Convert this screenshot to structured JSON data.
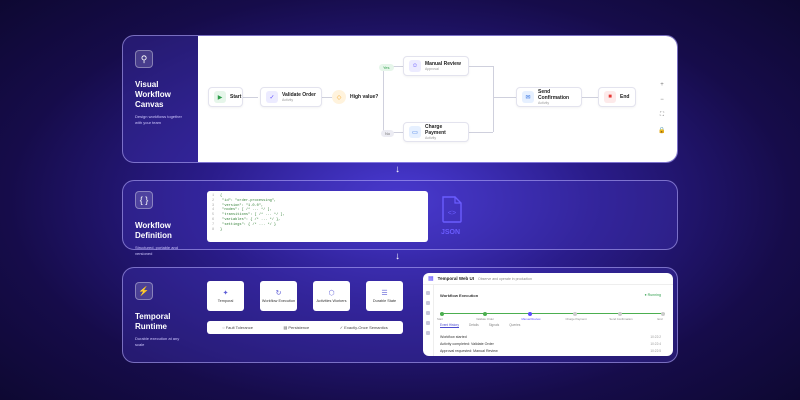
{
  "sections": {
    "canvas": {
      "title": "Visual Workflow Canvas",
      "desc": "Design workflows together with your team"
    },
    "definition": {
      "title": "Workflow Definition",
      "desc": "Structured, portable and versioned"
    },
    "runtime": {
      "title": "Temporal Runtime",
      "desc": "Durable execution at any scale"
    }
  },
  "canvas_nodes": {
    "start": "Start",
    "validate": {
      "title": "Validate Order",
      "sub": "Activity"
    },
    "decision": "High value?",
    "manual": {
      "title": "Manual Review",
      "sub": "Approval"
    },
    "charge": {
      "title": "Charge Payment",
      "sub": "Activity"
    },
    "confirm": {
      "title": "Send Confirmation",
      "sub": "Activity"
    },
    "end": "End",
    "yes": "Yes",
    "no": "No"
  },
  "canvas_tools": [
    "+",
    "−",
    "⛶",
    "🔒"
  ],
  "code_lines": [
    "{",
    "  \"id\": \"order-processing\",",
    "  \"version\": \"1.0.0\",",
    "  \"nodes\": [ /* ... */ ],",
    "  \"transitions\": [ /* ... */ ],",
    "  \"variables\": { /* ... */ },",
    "  \"settings\": { /* ... */ }",
    "}"
  ],
  "json_label": "JSON",
  "runtime_boxes": [
    "Temporal",
    "Workflow Execution",
    "Activities Workers",
    "Durable State"
  ],
  "features": [
    "Fault Tolerance",
    "Persistence",
    "Exactly-Once Semantics"
  ],
  "web_ui": {
    "title": "Temporal Web UI",
    "subtitle": "Observe and operate in production",
    "execution": "Workflow Execution",
    "status": "Running",
    "steps": [
      "Start",
      "Validate Order",
      "Manual Review",
      "Charge Payment",
      "Send Confirmation",
      "End"
    ],
    "tabs": [
      "Event History",
      "Details",
      "Signals",
      "Queries"
    ],
    "events": [
      {
        "text": "Workflow started",
        "time": "10:22:2"
      },
      {
        "text": "Activity completed: Validate Order",
        "time": "10:22:4"
      },
      {
        "text": "Approval requested: Manual Review",
        "time": "10:22:5"
      }
    ]
  },
  "colors": {
    "accent": "#5b4bff",
    "success": "#4caf50",
    "danger": "#e53935",
    "warn": "#f5a623"
  }
}
